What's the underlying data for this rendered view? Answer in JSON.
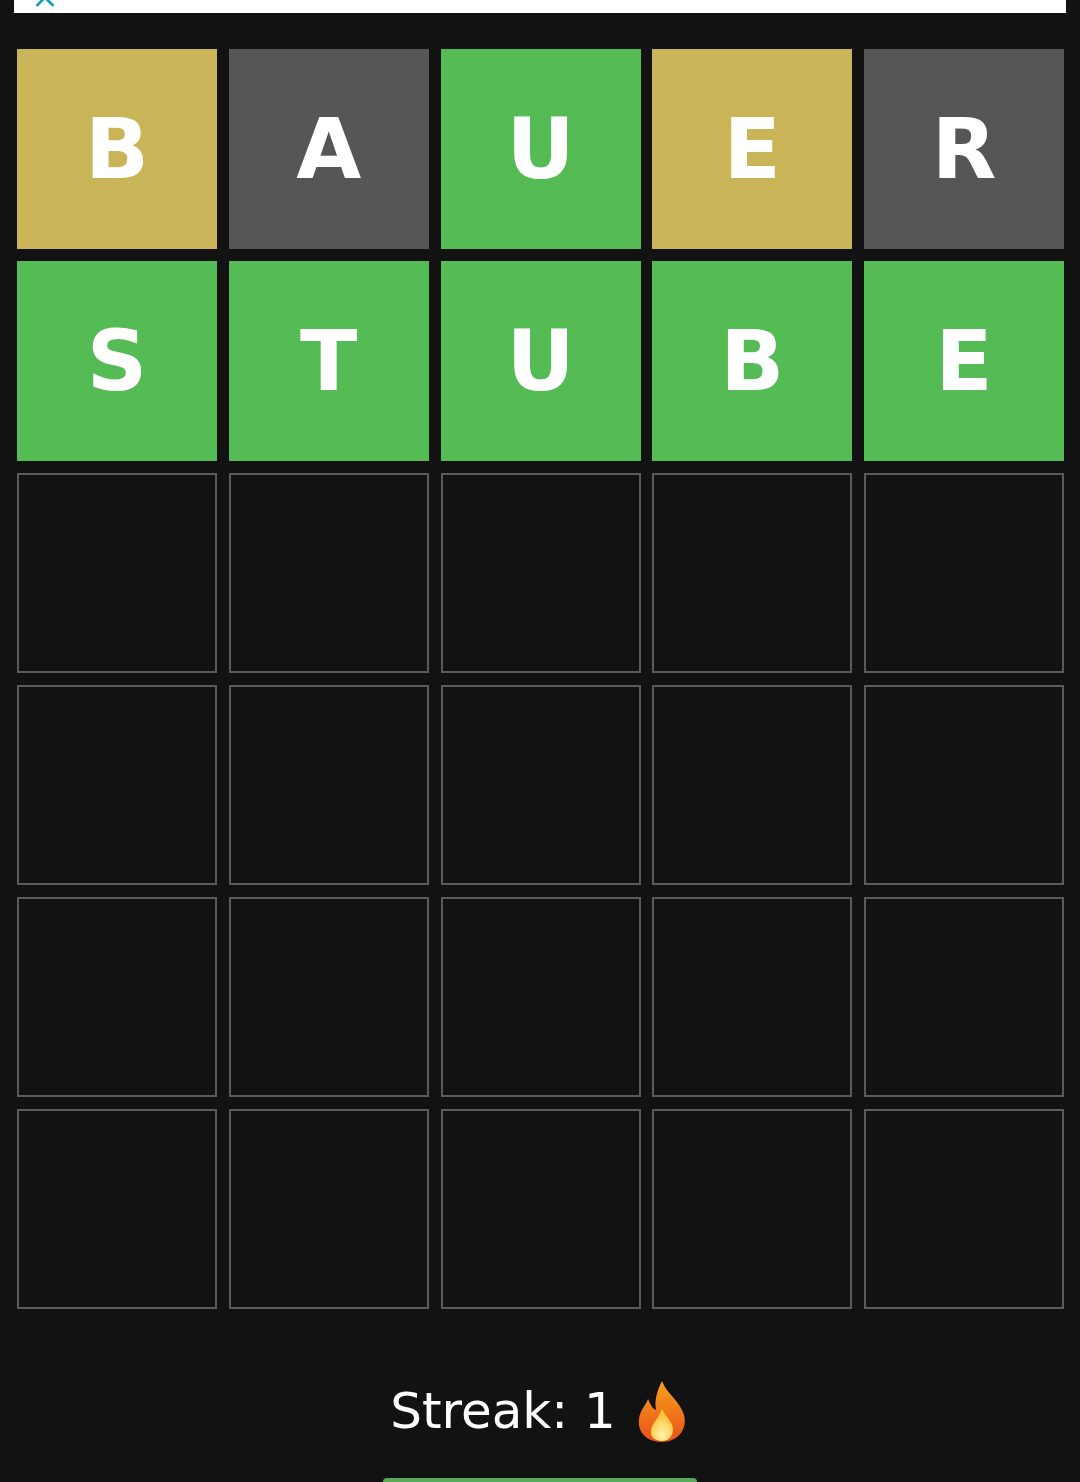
{
  "board": [
    {
      "tiles": [
        {
          "letter": "B",
          "kind": "present"
        },
        {
          "letter": "A",
          "kind": "absent"
        },
        {
          "letter": "U",
          "kind": "correct"
        },
        {
          "letter": "E",
          "kind": "present"
        },
        {
          "letter": "R",
          "kind": "absent"
        }
      ]
    },
    {
      "tiles": [
        {
          "letter": "S",
          "kind": "correct"
        },
        {
          "letter": "T",
          "kind": "correct"
        },
        {
          "letter": "U",
          "kind": "correct"
        },
        {
          "letter": "B",
          "kind": "correct"
        },
        {
          "letter": "E",
          "kind": "correct"
        }
      ]
    },
    {
      "tiles": [
        {
          "kind": "empty"
        },
        {
          "kind": "empty"
        },
        {
          "kind": "empty"
        },
        {
          "kind": "empty"
        },
        {
          "kind": "empty"
        }
      ]
    },
    {
      "tiles": [
        {
          "kind": "empty"
        },
        {
          "kind": "empty"
        },
        {
          "kind": "empty"
        },
        {
          "kind": "empty"
        },
        {
          "kind": "empty"
        }
      ]
    },
    {
      "tiles": [
        {
          "kind": "empty"
        },
        {
          "kind": "empty"
        },
        {
          "kind": "empty"
        },
        {
          "kind": "empty"
        },
        {
          "kind": "empty"
        }
      ]
    },
    {
      "tiles": [
        {
          "kind": "empty"
        },
        {
          "kind": "empty"
        },
        {
          "kind": "empty"
        },
        {
          "kind": "empty"
        },
        {
          "kind": "empty"
        }
      ]
    }
  ],
  "streak": {
    "label": "Streak: 1"
  },
  "action_button": {
    "kind": "button"
  }
}
